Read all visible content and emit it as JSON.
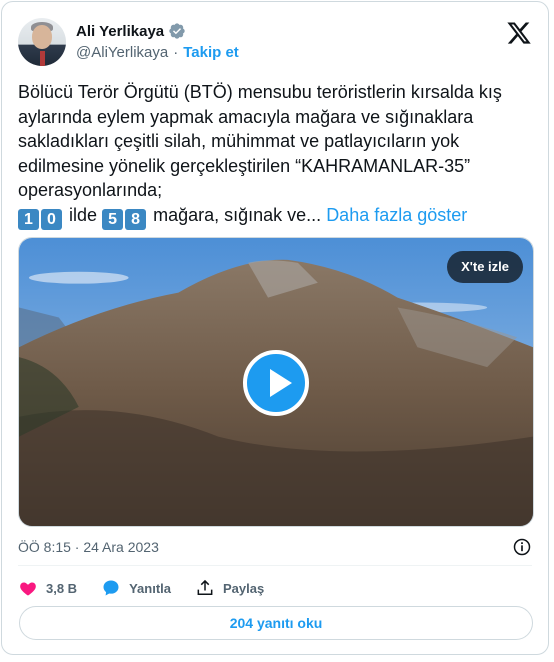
{
  "author": {
    "name": "Ali Yerlikaya",
    "handle": "@AliYerlikaya",
    "separator": "·",
    "follow_label": "Takip et",
    "verified": true
  },
  "tweet": {
    "text_main": "Bölücü Terör Örgütü (BTÖ) mensubu teröristlerin kırsalda kış aylarında eylem yapmak amacıyla mağara ve sığınaklara sakladıkları çeşitli silah, mühimmat ve patlayıcıların yok edilmesine yönelik gerçekleştirilen “KAHRAMANLAR-35” operasyonlarında;",
    "emoji_1": "1",
    "emoji_2": "0",
    "word_il": "ilde",
    "emoji_3": "5",
    "emoji_4": "8",
    "text_tail": "mağara, sığınak ve...",
    "show_more": "Daha fazla göster"
  },
  "media": {
    "watch_label": "X'te izle",
    "play_icon": "play-icon"
  },
  "meta": {
    "timestamp": "ÖÖ 8:15 · 24 Ara 2023"
  },
  "actions": {
    "likes": "3,8 B",
    "reply_label": "Yanıtla",
    "share_label": "Paylaş"
  },
  "footer": {
    "read_replies": "204 yanıtı oku"
  },
  "colors": {
    "accent": "#1d9bf0",
    "like": "#f91880",
    "text": "#0f1419",
    "muted": "#536471"
  }
}
